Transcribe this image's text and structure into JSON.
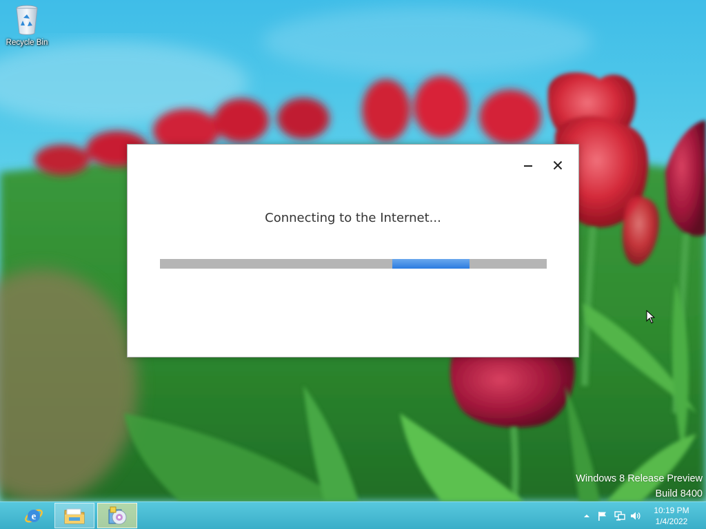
{
  "desktop": {
    "icons": [
      {
        "label": "Recycle Bin",
        "icon": "recycle-bin-icon"
      }
    ],
    "watermark": {
      "line1": "Windows 8 Release Preview",
      "line2": "Build 8400"
    }
  },
  "dialog": {
    "message": "Connecting to the Internet...",
    "progress": {
      "indeterminate": true,
      "marquee_start": 0.6,
      "marquee_end": 0.8
    },
    "buttons": {
      "minimize": "minimize-icon",
      "close": "close-icon"
    }
  },
  "taskbar": {
    "pinned": [
      {
        "name": "Internet Explorer",
        "icon": "internet-explorer-icon"
      },
      {
        "name": "File Explorer",
        "icon": "file-explorer-icon"
      },
      {
        "name": "Windows Setup",
        "icon": "setup-disc-icon"
      }
    ],
    "tray": {
      "icons": [
        "show-hidden-icons-arrow-icon",
        "action-center-flag-icon",
        "network-icon",
        "volume-icon"
      ],
      "time": "10:19 PM",
      "date": "1/4/2022"
    }
  },
  "colors": {
    "taskbar": "#48bcd4",
    "progress_track": "#b5b5b5",
    "progress_fill": "#3a86e4",
    "dialog_background": "#ffffff"
  }
}
